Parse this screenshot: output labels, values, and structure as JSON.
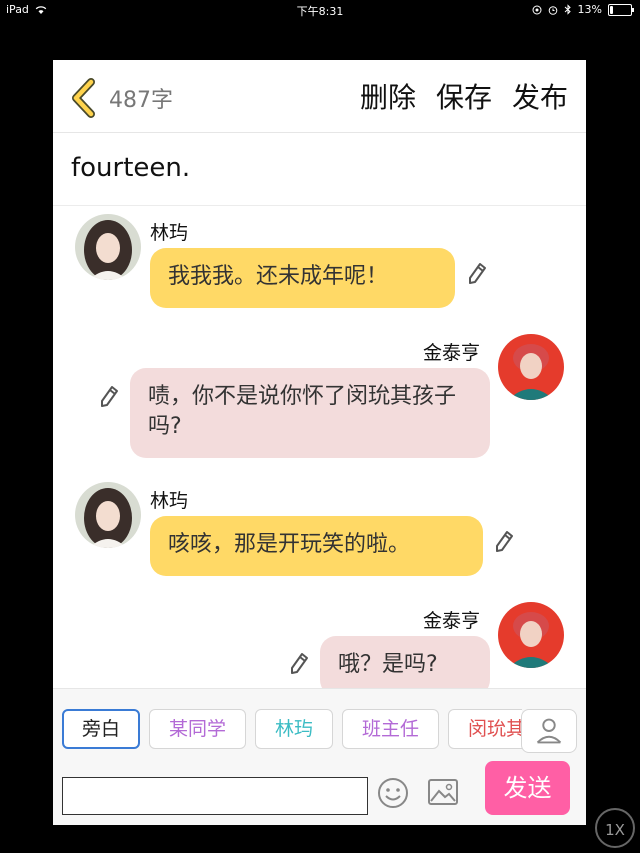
{
  "status_bar": {
    "device": "iPad",
    "time": "下午8:31",
    "battery": "13%",
    "battery_level": 0.13
  },
  "header": {
    "word_count": "487字",
    "actions": [
      "删除",
      "保存",
      "发布"
    ]
  },
  "story": {
    "title": "fourteen."
  },
  "messages": [
    {
      "speaker": "林玙",
      "text": "我我我。还未成年呢！",
      "side": "left",
      "color": "#ffd966"
    },
    {
      "speaker": "金泰亨",
      "text": "啧，你不是说你怀了闵玧其孩子吗?",
      "side": "right",
      "color": "#f3dcdc"
    },
    {
      "speaker": "林玙",
      "text": "咳咳，那是开玩笑的啦。",
      "side": "left",
      "color": "#ffd966"
    },
    {
      "speaker": "金泰亨",
      "text": "哦？是吗?",
      "side": "right",
      "color": "#f3dcdc"
    }
  ],
  "characters": [
    {
      "label": "旁白",
      "color": "#222222",
      "selected": true
    },
    {
      "label": "某同学",
      "color": "#b36ad6",
      "selected": false
    },
    {
      "label": "林玙",
      "color": "#3bbcc4",
      "selected": false
    },
    {
      "label": "班主任",
      "color": "#b36ad6",
      "selected": false
    },
    {
      "label": "闵玧其",
      "color": "#e05050",
      "selected": false
    }
  ],
  "composer": {
    "input_value": "",
    "send_label": "发送"
  },
  "zoom": {
    "label": "1X"
  }
}
